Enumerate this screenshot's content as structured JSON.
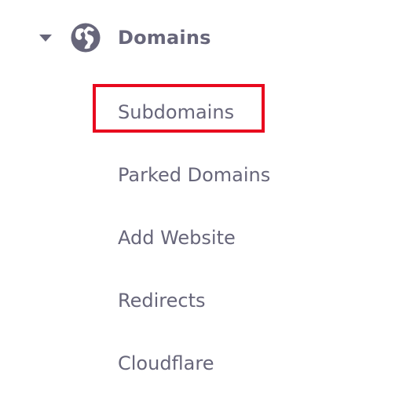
{
  "section": {
    "title": "Domains",
    "icon": "globe-icon",
    "expanded": true
  },
  "submenu": {
    "items": [
      {
        "label": "Subdomains",
        "highlighted": true
      },
      {
        "label": "Parked Domains"
      },
      {
        "label": "Add Website"
      },
      {
        "label": "Redirects"
      },
      {
        "label": "Cloudflare"
      }
    ]
  },
  "colors": {
    "text": "#67667a",
    "highlight": "#e8091e"
  }
}
